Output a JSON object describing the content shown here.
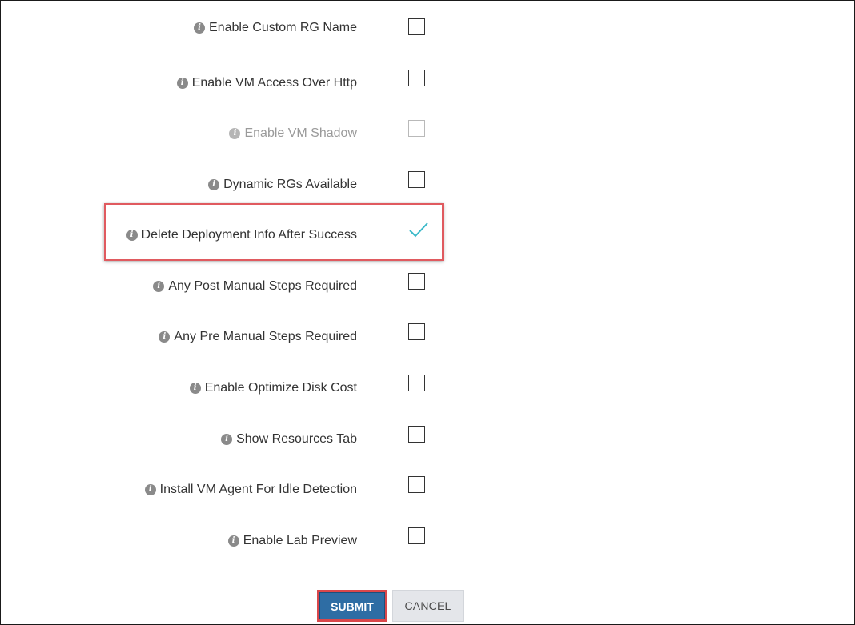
{
  "settings": [
    {
      "label": "Enable Custom RG Name",
      "checked": false,
      "disabled": false
    },
    {
      "label": "Enable VM Access Over Http",
      "checked": false,
      "disabled": false
    },
    {
      "label": "Enable VM Shadow",
      "checked": false,
      "disabled": true
    },
    {
      "label": "Dynamic RGs Available",
      "checked": false,
      "disabled": false
    },
    {
      "label": "Delete Deployment Info After Success",
      "checked": true,
      "disabled": false
    },
    {
      "label": "Any Post Manual Steps Required",
      "checked": false,
      "disabled": false
    },
    {
      "label": "Any Pre Manual Steps Required",
      "checked": false,
      "disabled": false
    },
    {
      "label": "Enable Optimize Disk Cost",
      "checked": false,
      "disabled": false
    },
    {
      "label": "Show Resources Tab",
      "checked": false,
      "disabled": false
    },
    {
      "label": "Install VM Agent For Idle Detection",
      "checked": false,
      "disabled": false
    },
    {
      "label": "Enable Lab Preview",
      "checked": false,
      "disabled": false
    }
  ],
  "icons": {
    "info": "info-icon",
    "checkmark": "checkmark-icon"
  },
  "buttons": {
    "submit_label": "SUBMIT",
    "cancel_label": "CANCEL"
  },
  "colors": {
    "primary": "#2e6da4",
    "highlight": "#e05a5f",
    "checkmark": "#3bb9c9",
    "cancel_bg": "#e4e6ea"
  }
}
